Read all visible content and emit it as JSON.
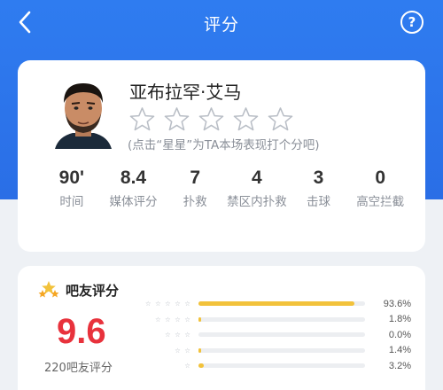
{
  "header": {
    "title": "评分"
  },
  "player": {
    "name": "亚布拉罕·艾马",
    "hint": "(点击“星星”为TA本场表现打个分吧)",
    "star_count": 5
  },
  "stats": [
    {
      "value": "90'",
      "label": "时间"
    },
    {
      "value": "8.4",
      "label": "媒体评分"
    },
    {
      "value": "7",
      "label": "扑救"
    },
    {
      "value": "4",
      "label": "禁区内扑救"
    },
    {
      "value": "3",
      "label": "击球"
    },
    {
      "value": "0",
      "label": "高空拦截"
    }
  ],
  "fan_rating": {
    "title": "吧友评分",
    "score": "9.6",
    "votes": "220吧友评分",
    "distribution": [
      {
        "stars": 5,
        "stars_text": "☆ ☆ ☆ ☆ ☆",
        "percent": 93.6,
        "label": "93.6%"
      },
      {
        "stars": 4,
        "stars_text": "☆ ☆ ☆ ☆",
        "percent": 1.8,
        "label": "1.8%"
      },
      {
        "stars": 3,
        "stars_text": "☆ ☆ ☆",
        "percent": 0.0,
        "label": "0.0%"
      },
      {
        "stars": 2,
        "stars_text": "☆ ☆",
        "percent": 1.4,
        "label": "1.4%"
      },
      {
        "stars": 1,
        "stars_text": "☆",
        "percent": 3.2,
        "label": "3.2%"
      }
    ]
  },
  "colors": {
    "header_blue": "#2f7cf0",
    "score_red": "#e8323c",
    "bar_gold": "#f2c23b"
  }
}
